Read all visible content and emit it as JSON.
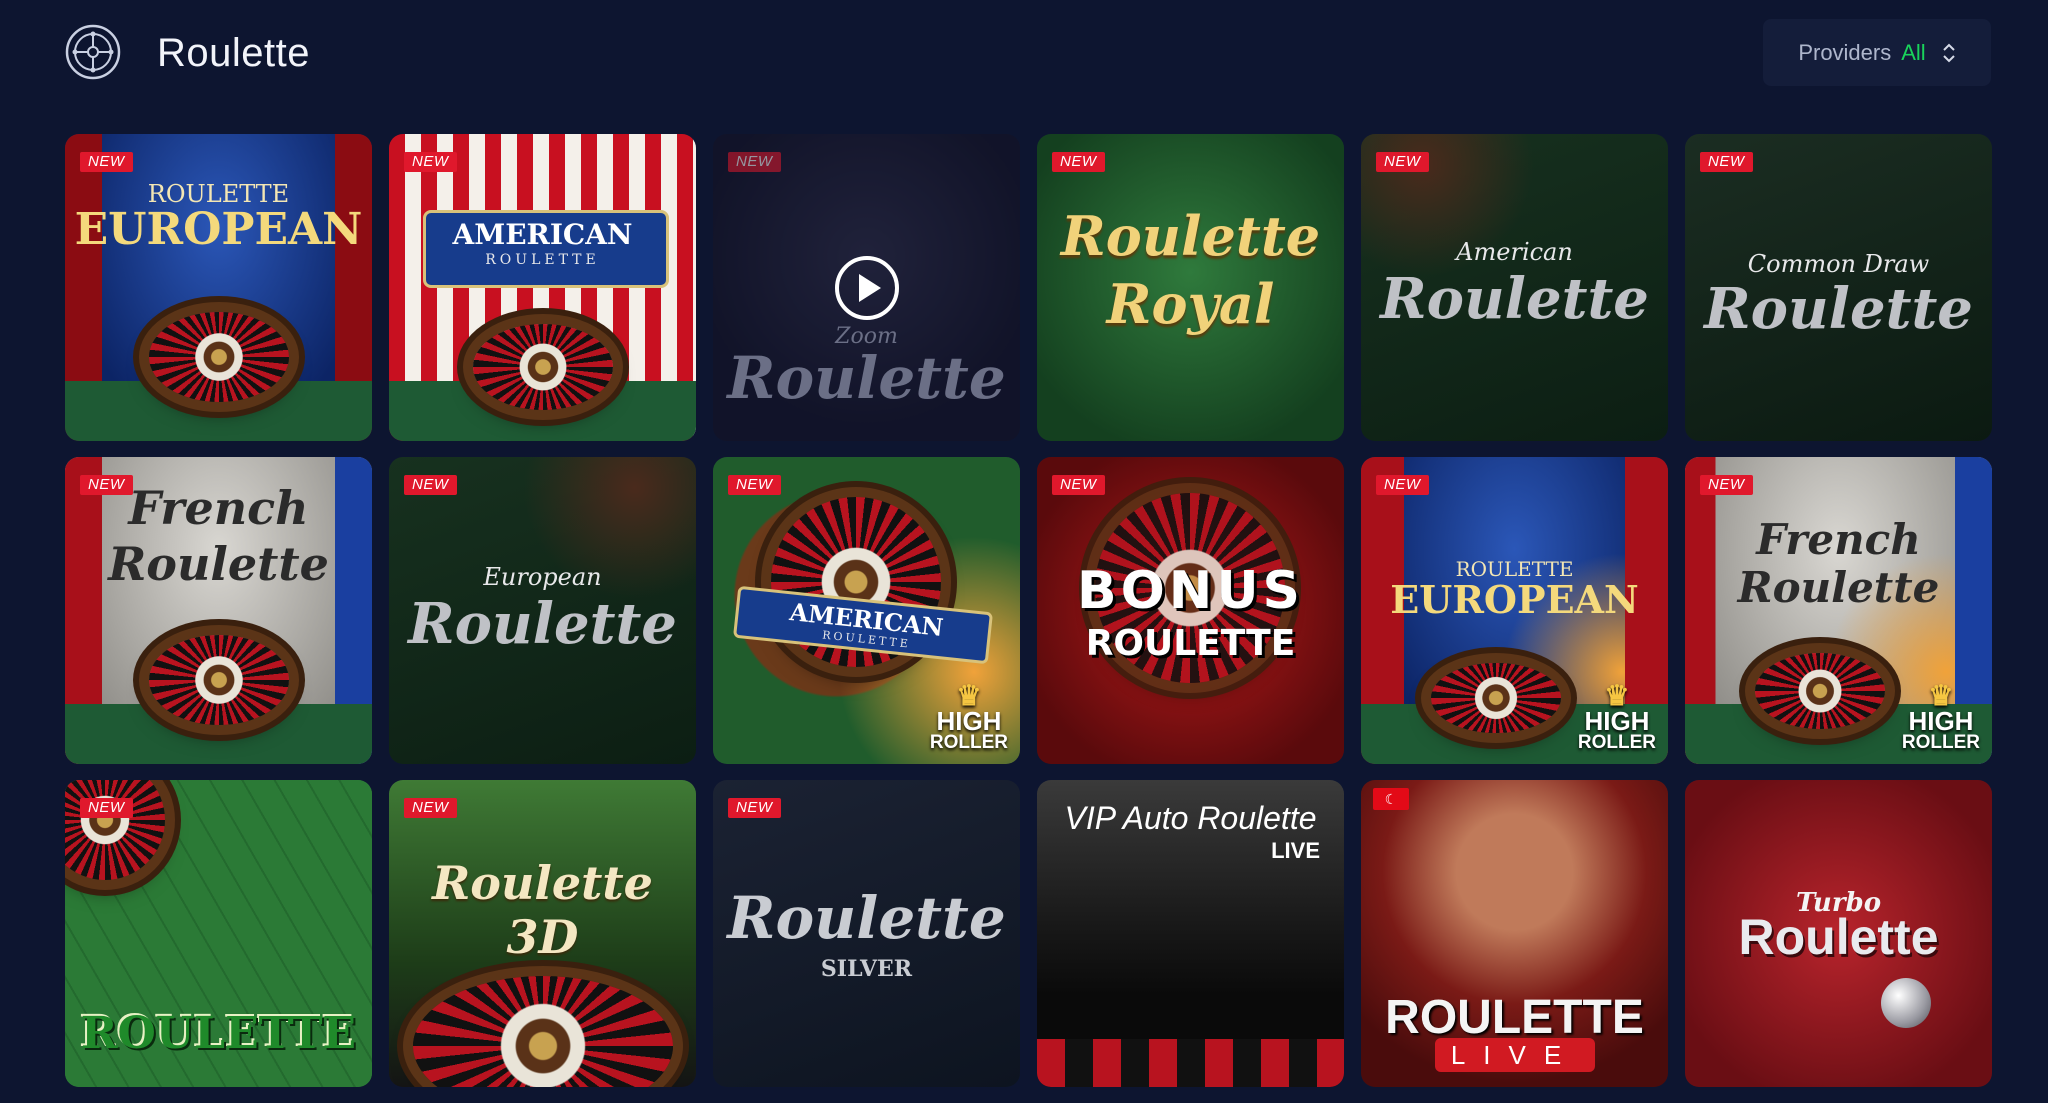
{
  "header": {
    "category_icon": "roulette-wheel-icon",
    "title": "Roulette",
    "providers_label": "Providers",
    "providers_value": "All",
    "providers_icon": "chevron-up-down-icon"
  },
  "colors": {
    "background": "#0d1530",
    "providers_value": "#19d45b",
    "new_badge": "#e0182c"
  },
  "games": [
    {
      "badge": "NEW",
      "sub": "ROULETTE",
      "main": "EUROPEAN"
    },
    {
      "badge": "NEW",
      "sub": "AMERICAN",
      "main": "ROULETTE"
    },
    {
      "badge": "NEW",
      "sub": "Zoom",
      "main": "Roulette"
    },
    {
      "badge": "NEW",
      "sub": "Roulette",
      "main": "Royal"
    },
    {
      "badge": "NEW",
      "sub": "American",
      "main": "Roulette"
    },
    {
      "badge": "NEW",
      "sub": "Common Draw",
      "main": "Roulette"
    },
    {
      "badge": "NEW",
      "sub": "French",
      "main": "Roulette"
    },
    {
      "badge": "NEW",
      "sub": "European",
      "main": "Roulette"
    },
    {
      "badge": "NEW",
      "sub": "AMERICAN",
      "main": "ROULETTE",
      "hr1": "HIGH",
      "hr2": "ROLLER"
    },
    {
      "badge": "NEW",
      "sub": "BONUS",
      "main": "ROULETTE"
    },
    {
      "badge": "NEW",
      "sub": "ROULETTE",
      "main": "EUROPEAN",
      "hr1": "HIGH",
      "hr2": "ROLLER"
    },
    {
      "badge": "NEW",
      "sub": "French",
      "main": "Roulette",
      "hr1": "HIGH",
      "hr2": "ROLLER"
    },
    {
      "badge": "NEW",
      "main": "ROULETTE"
    },
    {
      "badge": "NEW",
      "main": "Roulette 3D"
    },
    {
      "badge": "NEW",
      "main": "Roulette",
      "sub": "SILVER"
    },
    {
      "main": "VIP Auto Roulette",
      "sub": "LIVE"
    },
    {
      "main": "ROULETTE",
      "sub": "LIVE"
    },
    {
      "sub": "Turbo",
      "main": "Roulette"
    }
  ]
}
